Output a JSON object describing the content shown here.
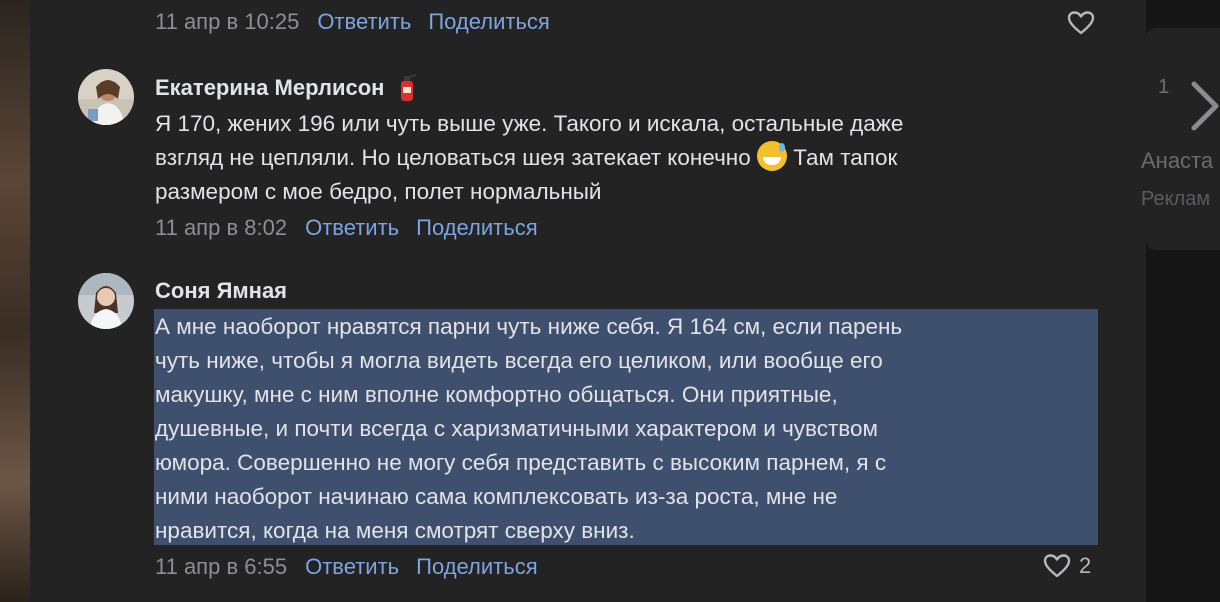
{
  "comments": [
    {
      "date": "11 апр в 10:25",
      "reply": "Ответить",
      "share": "Поделиться"
    },
    {
      "author": "Екатерина Мерлисон",
      "badge": "fire-extinguisher-emoji",
      "text_line1": "Я 170, жених 196 или чуть выше уже. Такого и искала, остальные даже",
      "text_line2a": "взгляд не цепляли. Но целоваться шея затекает конечно ",
      "emoji": "grinning-face-with-sweat",
      "text_line2b": " Там тапок",
      "text_line3": "размером с мое бедро, полет нормальный",
      "date": "11 апр в 8:02",
      "reply": "Ответить",
      "share": "Поделиться"
    },
    {
      "author": "Соня Ямная",
      "lines": [
        "А мне наоборот нравятся парни чуть ниже себя. Я 164 см, если парень",
        "чуть ниже, чтобы я могла видеть всегда его целиком, или вообще его",
        "макушку, мне с ним вполне комфортно общаться. Они приятные,",
        "душевные, и почти всегда с харизматичными характером и чувством",
        "юмора. Совершенно не могу себя представить с высоким парнем, я с",
        "ними наоборот начинаю сама комплексовать из-за роста, мне не",
        "нравится, когда на меня смотрят сверху вниз."
      ],
      "date": "11 апр в 6:55",
      "reply": "Ответить",
      "share": "Поделиться",
      "likes": "2"
    }
  ],
  "sidebar": {
    "counter": "1",
    "name": "Анаста",
    "ad": "Реклам"
  },
  "colors": {
    "background": "#232324",
    "link": "#7ea4e0",
    "meta": "#8e8e93",
    "text": "#e1e3e6",
    "selection": "#3e506e"
  },
  "icons": {
    "like": "heart-icon",
    "next": "chevron-right-icon"
  }
}
